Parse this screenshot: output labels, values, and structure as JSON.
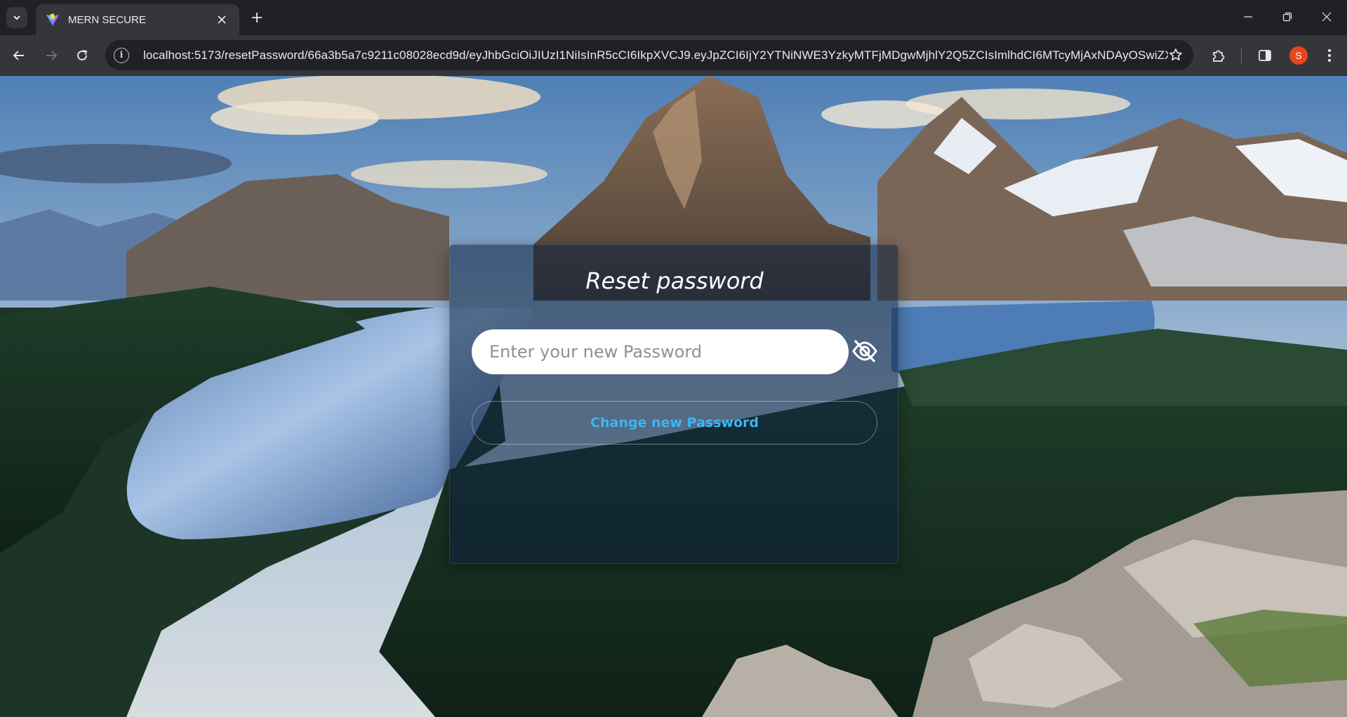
{
  "browser": {
    "tab": {
      "title": "MERN SECURE",
      "favicon": "vite-favicon"
    },
    "url": "localhost:5173/resetPassword/66a3b5a7c9211c08028ecd9d/eyJhbGciOiJIUzI1NiIsInR5cCI6IkpXVCJ9.eyJpZCI6IjY2YTNiNWE3YzkyMTFjMDgwMjhlY2Q5ZCIsImlhdCI6MTcyMjAxNDAyOSwiZXh...",
    "profile_initial": "S",
    "icons": [
      "tab-search-icon",
      "close-icon",
      "plus-icon",
      "minimize-icon",
      "restore-icon",
      "back-arrow-icon",
      "forward-arrow-icon",
      "reload-icon",
      "site-info-icon",
      "bookmark-star-icon",
      "extensions-icon",
      "side-panel-icon",
      "more-menu-icon"
    ]
  },
  "reset_form": {
    "title": "Reset password",
    "password_placeholder": "Enter your new Password",
    "password_value": "",
    "submit_label": "Change new Password",
    "visibility_icon": "eye-slash-icon"
  },
  "colors": {
    "accent": "#3fb4f2",
    "profile_avatar": "#e8461d",
    "card_background": "rgba(12,32,62,0.55)"
  }
}
